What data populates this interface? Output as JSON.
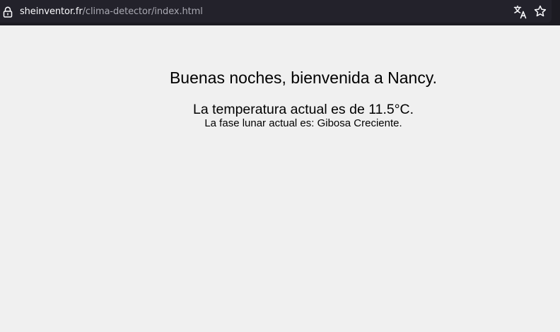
{
  "browser": {
    "url_domain": "sheinventor.fr",
    "url_path": "/clima-detector/index.html",
    "icons": {
      "lock": "lock-icon",
      "translate": "translate-icon",
      "bookmark": "star-icon"
    }
  },
  "page": {
    "greeting": "Buenas noches, bienvenida a Nancy.",
    "temperature_text": "La temperatura actual es de 11.5°C.",
    "moon_phase_text": "La fase lunar actual es: Gibosa Creciente."
  },
  "colors": {
    "toolbar_bg": "#1c1b22",
    "page_bg": "#f0f0f0",
    "text": "#000000"
  }
}
